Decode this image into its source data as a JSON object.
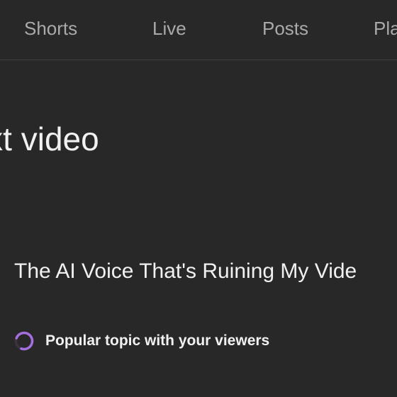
{
  "tabs": [
    {
      "label": "Shorts"
    },
    {
      "label": "Live"
    },
    {
      "label": "Posts"
    },
    {
      "label": "Pla"
    }
  ],
  "section": {
    "title": "next video"
  },
  "idea": {
    "title": "The AI Voice That's Ruining My Vide",
    "reason": "Popular topic with your viewers",
    "reason_icon": "trending-ring-icon",
    "accent_color": "#a56fe0"
  },
  "colors": {
    "background": "#282828",
    "tab_text": "#aaaaaa",
    "text": "#f1f1f1",
    "divider": "#3f3f3f"
  }
}
